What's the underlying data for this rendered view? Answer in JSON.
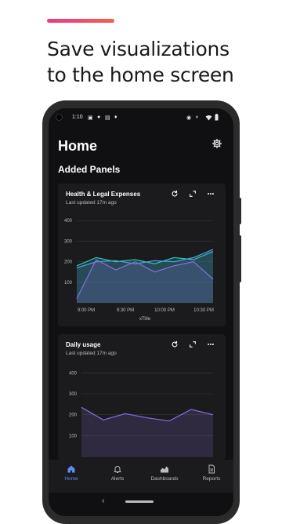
{
  "promo": {
    "headline_line1": "Save visualizations",
    "headline_line2": "to the home screen",
    "accent_colors": [
      "#e73a8c",
      "#f4604d"
    ]
  },
  "status_bar": {
    "time": "1:10",
    "left_icons": [
      "gallery-icon",
      "person-icon",
      "news-icon",
      "mic-icon"
    ],
    "right_icons": [
      "location-icon",
      "eye-icon",
      "wifi-icon",
      "battery-icon"
    ]
  },
  "header": {
    "title": "Home",
    "settings_icon": "gear-icon"
  },
  "section_title": "Added Panels",
  "panels": [
    {
      "title": "Health & Legal Expenses",
      "subtitle": "Last updated 17m ago",
      "actions": [
        "refresh-icon",
        "expand-icon",
        "more-icon"
      ]
    },
    {
      "title": "Daily usage",
      "subtitle": "Last updated 17m ago",
      "actions": [
        "refresh-icon",
        "expand-icon",
        "more-icon"
      ]
    }
  ],
  "chart_data": [
    {
      "type": "area",
      "title": "",
      "xlabel": "xTitle",
      "ylabel": "",
      "x_ticks": [
        "9:00 PM",
        "9:30 PM",
        "10:00 PM",
        "10:30 PM"
      ],
      "y_ticks": [
        100,
        200,
        300,
        400
      ],
      "ylim": [
        0,
        420
      ],
      "grid": true,
      "series": [
        {
          "color": "#2ec4b6",
          "x": [
            0,
            1,
            2,
            3,
            4,
            5,
            6,
            7
          ],
          "values": [
            180,
            220,
            200,
            210,
            190,
            220,
            210,
            250
          ]
        },
        {
          "color": "#4ea3e0",
          "x": [
            0,
            1,
            2,
            3,
            4,
            5,
            6,
            7
          ],
          "values": [
            170,
            200,
            205,
            190,
            205,
            200,
            220,
            260
          ]
        },
        {
          "color": "#8a6ee0",
          "x": [
            0,
            1,
            2,
            3,
            4,
            5,
            6,
            7
          ],
          "values": [
            20,
            210,
            160,
            200,
            150,
            180,
            200,
            115
          ]
        }
      ]
    },
    {
      "type": "area",
      "title": "",
      "xlabel": "",
      "ylabel": "",
      "y_ticks": [
        100,
        200,
        300,
        400
      ],
      "ylim": [
        0,
        420
      ],
      "grid": true,
      "series": [
        {
          "color": "#8a6ee0",
          "x": [
            0,
            1,
            2,
            3,
            4,
            5,
            6
          ],
          "values": [
            235,
            175,
            205,
            185,
            170,
            225,
            200
          ]
        }
      ]
    }
  ],
  "bottom_nav": [
    {
      "label": "Home",
      "icon": "home-icon",
      "active": true
    },
    {
      "label": "Alerts",
      "icon": "bell-icon",
      "active": false
    },
    {
      "label": "Dashboards",
      "icon": "dashboards-icon",
      "active": false
    },
    {
      "label": "Reports",
      "icon": "reports-icon",
      "active": false
    }
  ],
  "colors": {
    "active_nav": "#5b8def",
    "background": "#101012",
    "card": "#1b1b1e"
  }
}
